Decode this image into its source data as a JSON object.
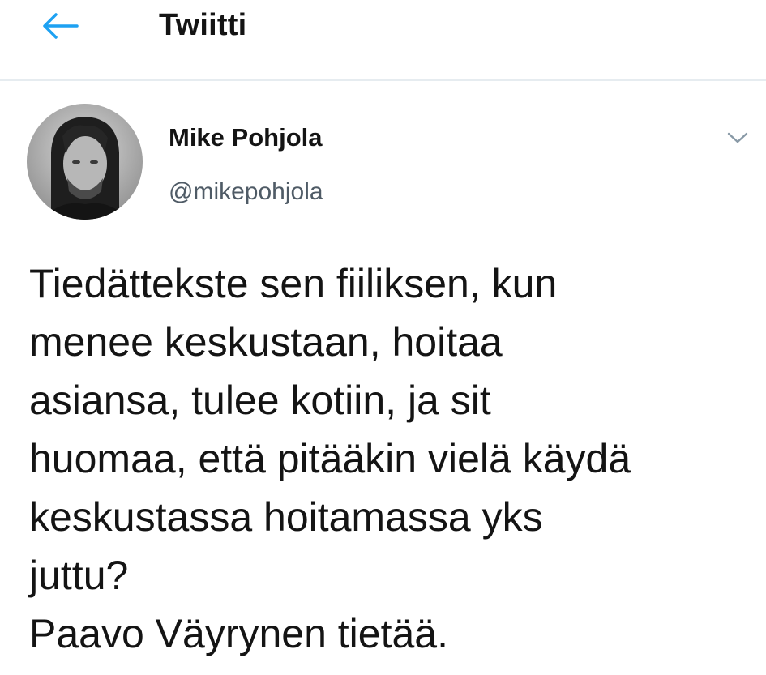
{
  "header": {
    "back_icon": "arrow-left-icon",
    "title": "Twiitti"
  },
  "colors": {
    "accent": "#1da1f2",
    "text": "#141414",
    "secondary": "#4f5b66",
    "divider": "#e6ecf0"
  },
  "tweet": {
    "author": {
      "display_name": "Mike Pohjola",
      "handle": "@mikepohjola",
      "avatar_icon": "avatar"
    },
    "menu_icon": "chevron-down-icon",
    "text": "Tiedättekste sen fiiliksen, kun\nmenee keskustaan, hoitaa\nasiansa, tulee kotiin, ja sit\nhuomaa, että pitääkin vielä käydä\nkeskustassa hoitamassa yks\njuttu?\nPaavo Väyrynen tietää."
  }
}
